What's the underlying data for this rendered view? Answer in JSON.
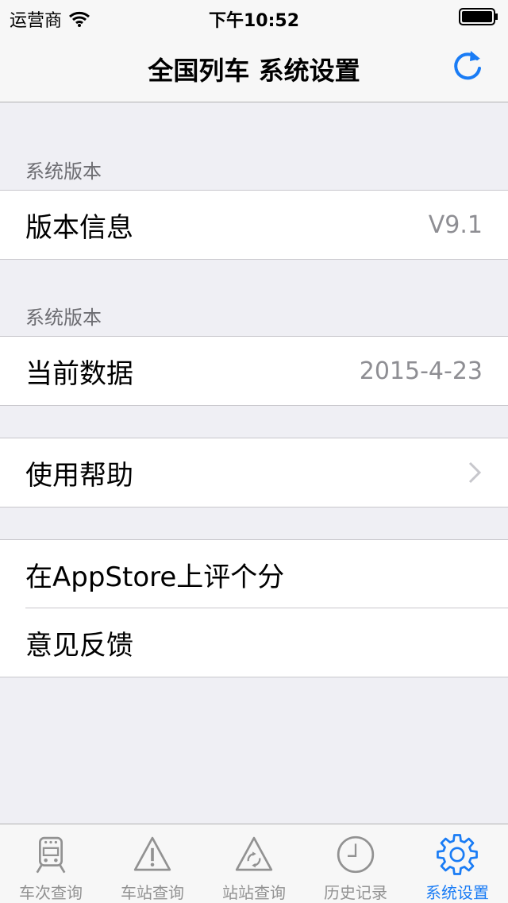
{
  "status_bar": {
    "carrier": "运营商",
    "time": "下午10:52"
  },
  "navbar": {
    "title": "全国列车 系统设置"
  },
  "sections": [
    {
      "header": "系统版本",
      "rows": [
        {
          "label": "版本信息",
          "value": "V9.1"
        }
      ]
    },
    {
      "header": "系统版本",
      "rows": [
        {
          "label": "当前数据",
          "value": "2015-4-23"
        }
      ]
    },
    {
      "rows": [
        {
          "label": "使用帮助"
        }
      ]
    },
    {
      "rows": [
        {
          "label": "在AppStore上评个分"
        },
        {
          "label": "意见反馈"
        }
      ]
    }
  ],
  "tabs": [
    {
      "label": "车次查询",
      "icon": "train-icon"
    },
    {
      "label": "车站查询",
      "icon": "warning-triangle-icon"
    },
    {
      "label": "站站查询",
      "icon": "station-triangle-icon"
    },
    {
      "label": "历史记录",
      "icon": "clock-icon"
    },
    {
      "label": "系统设置",
      "icon": "gear-icon",
      "active": true
    }
  ],
  "colors": {
    "accent": "#1a7cf5",
    "inactive": "#929292",
    "background": "#efeff4"
  }
}
